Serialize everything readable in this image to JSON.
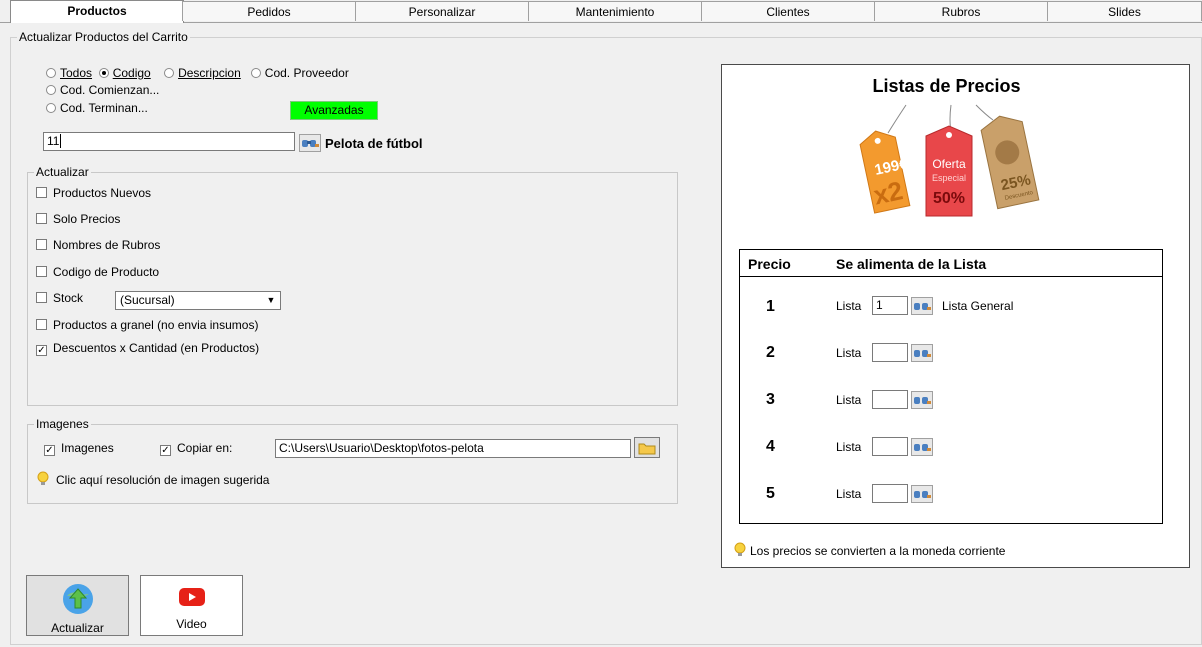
{
  "tabs": [
    "Productos",
    "Pedidos",
    "Personalizar",
    "Mantenimiento",
    "Clientes",
    "Rubros",
    "Slides"
  ],
  "group_title": "Actualizar Productos del Carrito",
  "search_mode": {
    "todos": "Todos",
    "codigo": "Codigo",
    "descripcion": "Descripcion",
    "cod_proveedor": "Cod. Proveedor",
    "cod_comienzan": "Cod. Comienzan...",
    "cod_terminan": "Cod. Terminan...",
    "selected": "Codigo"
  },
  "avanzadas_label": "Avanzadas",
  "codigo_input": "11",
  "product_name": "Pelota de fútbol",
  "actualizar": {
    "legend": "Actualizar",
    "items": [
      {
        "label": "Productos Nuevos",
        "checked": false
      },
      {
        "label": "Solo Precios",
        "checked": false
      },
      {
        "label": "Nombres de Rubros",
        "checked": false
      },
      {
        "label": "Codigo de Producto",
        "checked": false
      },
      {
        "label": "Stock",
        "checked": false
      },
      {
        "label": "Productos a granel (no envia insumos)",
        "checked": false
      },
      {
        "label": "Descuentos x Cantidad (en Productos)",
        "checked": true
      }
    ],
    "stock_select": "(Sucursal)"
  },
  "imagenes": {
    "legend": "Imagenes",
    "imagenes_label": "Imagenes",
    "imagenes_checked": true,
    "copiar_label": "Copiar en:",
    "copiar_checked": true,
    "path": "C:\\Users\\Usuario\\Desktop\\fotos-pelota",
    "hint": "Clic aquí resolución de imagen sugerida"
  },
  "buttons": {
    "actualizar": "Actualizar",
    "video": "Video"
  },
  "price_panel": {
    "title": "Listas de Precios",
    "tags": {
      "orange_top": "199€",
      "orange_bottom": "x2",
      "red_top": "Oferta",
      "red_mid": "Especial",
      "red_bottom": "50%",
      "brown_pct": "25%",
      "brown_sub": "Descuento"
    },
    "col_precio": "Precio",
    "col_lista": "Se alimenta de la Lista",
    "lista_label": "Lista",
    "rows": [
      {
        "precio": "1",
        "value": "1",
        "name": "Lista General"
      },
      {
        "precio": "2",
        "value": "",
        "name": ""
      },
      {
        "precio": "3",
        "value": "",
        "name": ""
      },
      {
        "precio": "4",
        "value": "",
        "name": ""
      },
      {
        "precio": "5",
        "value": "",
        "name": ""
      }
    ],
    "note": "Los precios se convierten a la moneda corriente"
  },
  "colors": {
    "avanzadas_bg": "#00ff00",
    "orange_tag": "#f39a2e",
    "red_tag": "#e8474a",
    "brown_tag": "#c9a06a",
    "video_red": "#e62117"
  }
}
